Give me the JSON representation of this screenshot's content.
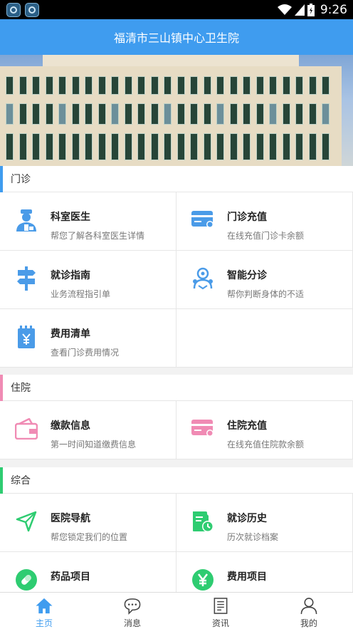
{
  "status_bar": {
    "time": "9:26"
  },
  "header": {
    "title": "福清市三山镇中心卫生院"
  },
  "colors": {
    "primary": "#3f9cef",
    "outpatient": "#3f9cef",
    "inpatient": "#f08bb4",
    "general": "#2ecc71"
  },
  "sections": [
    {
      "title": "门诊",
      "items": [
        {
          "title": "科室医生",
          "subtitle": "帮您了解各科室医生详情",
          "icon": "doctor-icon"
        },
        {
          "title": "门诊充值",
          "subtitle": "在线充值门诊卡余额",
          "icon": "card-icon"
        },
        {
          "title": "就诊指南",
          "subtitle": "业务流程指引单",
          "icon": "signpost-icon"
        },
        {
          "title": "智能分诊",
          "subtitle": "帮你判断身体的不适",
          "icon": "body-icon"
        },
        {
          "title": "费用清单",
          "subtitle": "查看门诊费用情况",
          "icon": "receipt-icon"
        }
      ]
    },
    {
      "title": "住院",
      "items": [
        {
          "title": "缴款信息",
          "subtitle": "第一时间知道缴费信息",
          "icon": "wallet-icon"
        },
        {
          "title": "住院充值",
          "subtitle": "在线充值住院款余额",
          "icon": "card-icon"
        }
      ]
    },
    {
      "title": "综合",
      "items": [
        {
          "title": "医院导航",
          "subtitle": "帮您锁定我们的位置",
          "icon": "navigation-icon"
        },
        {
          "title": "就诊历史",
          "subtitle": "历次就诊档案",
          "icon": "history-icon"
        },
        {
          "title": "药品项目",
          "subtitle": "",
          "icon": "pill-icon"
        },
        {
          "title": "费用项目",
          "subtitle": "",
          "icon": "yuan-icon"
        }
      ]
    }
  ],
  "tabbar": [
    {
      "label": "主页",
      "icon": "home-icon",
      "active": true
    },
    {
      "label": "消息",
      "icon": "chat-icon",
      "active": false
    },
    {
      "label": "资讯",
      "icon": "news-icon",
      "active": false
    },
    {
      "label": "我的",
      "icon": "user-icon",
      "active": false
    }
  ]
}
